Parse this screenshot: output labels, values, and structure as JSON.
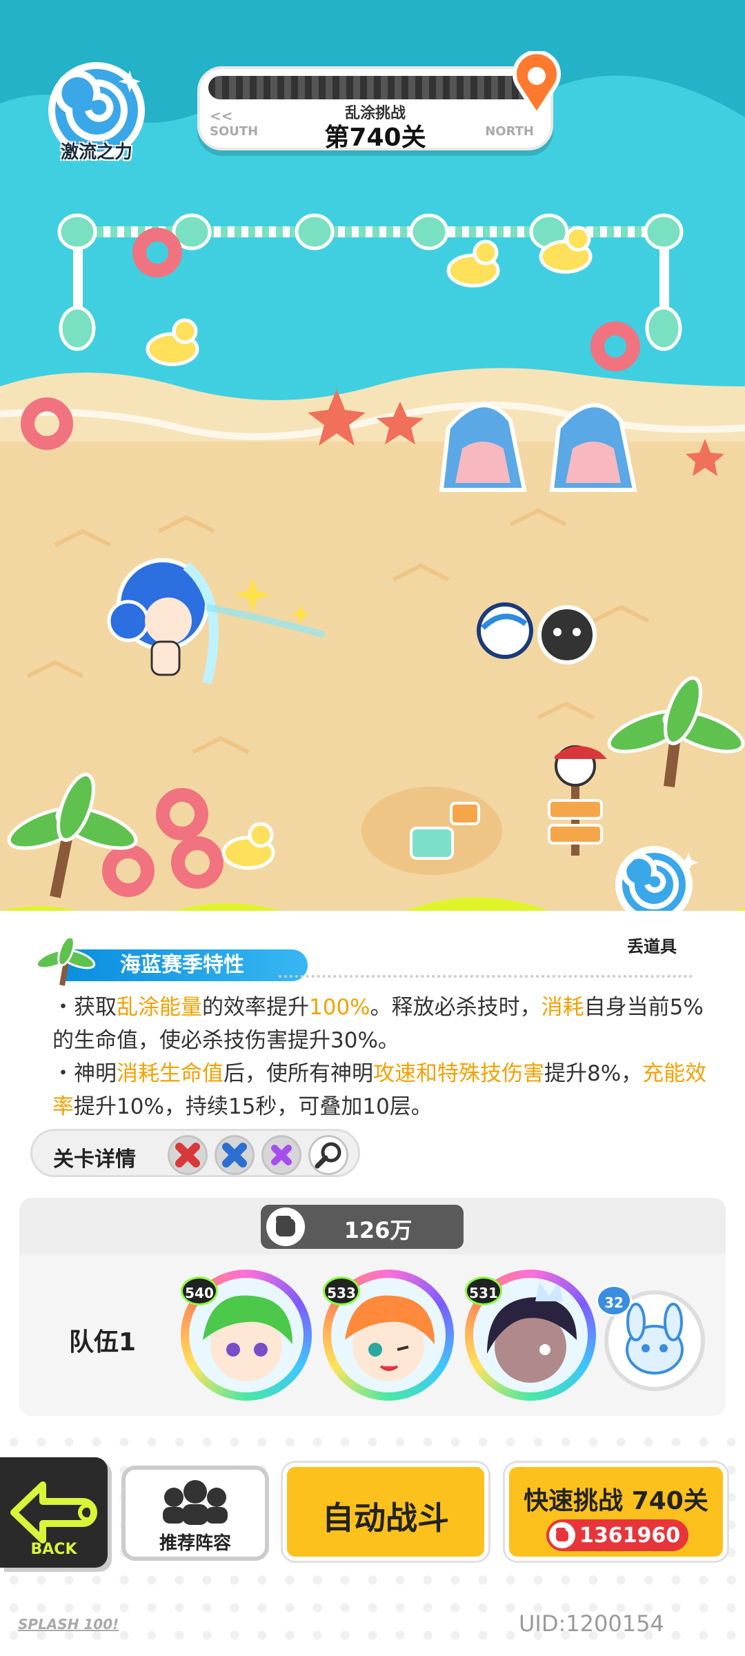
{
  "hud": {
    "logo_label": "激流之力",
    "stage_sub": "乱涂挑战",
    "stage_main": "第740关",
    "south_arrow": "<<",
    "south_label": "SOUTH",
    "north_label": "NORTH",
    "drop_item_label": "丢道具"
  },
  "season": {
    "title": "海蓝赛季特性",
    "line1_pre": "・获取",
    "line1_hl1": "乱涂能量",
    "line1_mid": "的效率提升",
    "line1_hl2": "100%",
    "line1_mid2": "。释放必杀技时，",
    "line1_hl3": "消耗",
    "line1_post": "自身当前5%的生命值，使必杀技伤害提升30%。",
    "line2_pre": "・神明",
    "line2_hl1": "消耗生命值",
    "line2_mid": "后，使所有神明",
    "line2_hl2": "攻速和特殊技伤害",
    "line2_mid2": "提升8%，",
    "line2_hl3": "充能效率",
    "line2_post": "提升10%，持续15秒，可叠加10层。"
  },
  "stage_detail": {
    "label": "关卡详情"
  },
  "team": {
    "power": "126万",
    "label": "队伍1",
    "heroes": [
      {
        "level": "540",
        "hair": "#4cc94a",
        "skin": "#ffe7d6"
      },
      {
        "level": "533",
        "hair": "#ff8a3c",
        "skin": "#ffe7d6"
      },
      {
        "level": "531",
        "hair": "#2a2340",
        "skin": "#b08a8a"
      }
    ],
    "pet_level": "32"
  },
  "buttons": {
    "back": "BACK",
    "recommend": "推荐阵容",
    "auto": "自动战斗",
    "quick": "快速挑战 740关",
    "quick_cost": "1361960"
  },
  "footer": {
    "brand": "SPLASH 100!",
    "uid": "UID:1200154"
  },
  "colors": {
    "sea": "#40cfe0",
    "sand": "#f3d7a2",
    "highlight": "#f5a000",
    "button_yellow": "#fcc11c"
  }
}
